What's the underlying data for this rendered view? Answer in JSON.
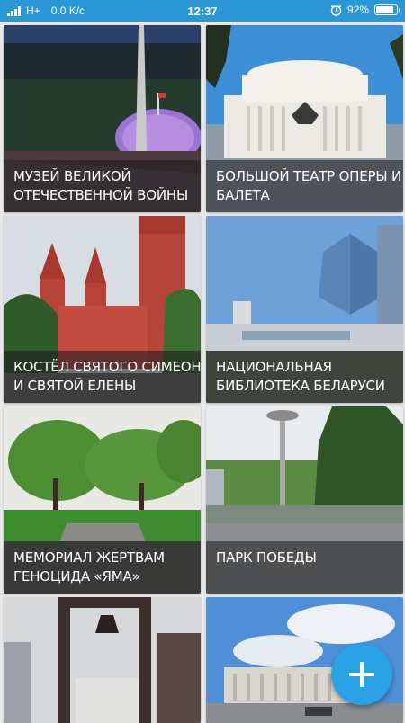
{
  "status_bar": {
    "network": "H+",
    "speed": "0.0 K/c",
    "time": "12:37",
    "battery_percent": "92%",
    "battery_level": 0.92,
    "icons": [
      "signal-icon",
      "alarm-icon",
      "battery-icon"
    ]
  },
  "places": [
    {
      "line1": "МУЗЕЙ ВЕЛИКОЙ",
      "line2": "ОТЕЧЕСТВЕННОЙ ВОЙНЫ"
    },
    {
      "line1": "БОЛЬШОЙ ТЕАТР ОПЕРЫ И",
      "line2": "БАЛЕТА"
    },
    {
      "line1": "КОСТЁЛ СВЯТОГО СИМЕОНА",
      "line2": "И СВЯТОЙ ЕЛЕНЫ"
    },
    {
      "line1": "НАЦИОНАЛЬНАЯ",
      "line2": "БИБЛИОТЕКА БЕЛАРУСИ"
    },
    {
      "line1": "МЕМОРИАЛ ЖЕРТВАМ",
      "line2": "ГЕНОЦИДА «ЯМА»"
    },
    {
      "line1": "ПАРК ПОБЕДЫ",
      "line2": ""
    },
    {
      "line1": "",
      "line2": ""
    },
    {
      "line1": "",
      "line2": ""
    }
  ],
  "fab": {
    "icon": "plus-icon",
    "color": "#2aa3e6"
  },
  "colors": {
    "status_bar": "#2b97d6",
    "background": "#e9e9e9"
  }
}
